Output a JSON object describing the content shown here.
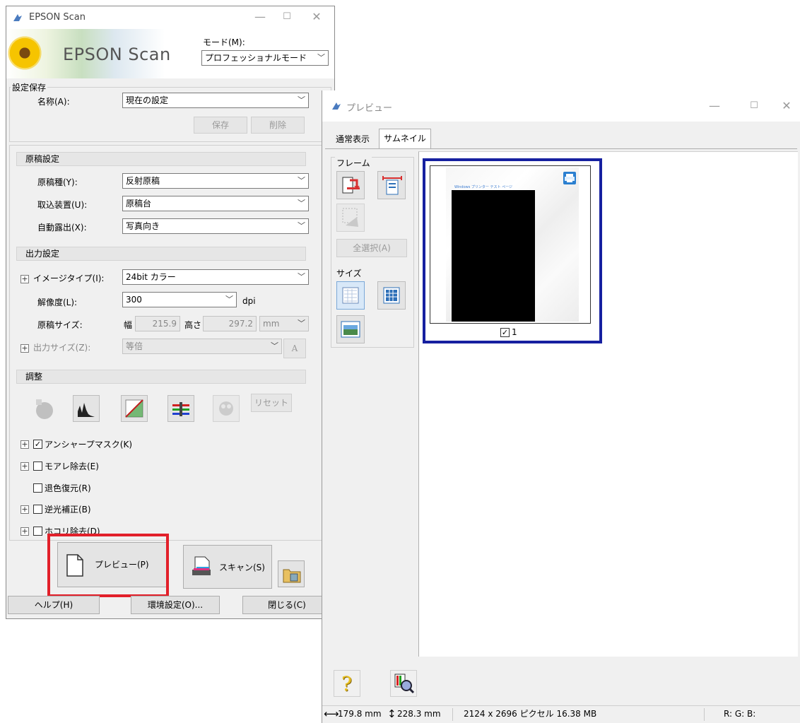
{
  "main": {
    "title": "EPSON Scan",
    "brand": "EPSON Scan",
    "mode_label": "モード(M):",
    "mode_value": "プロフェッショナルモード",
    "settings_save": {
      "group_title": "設定保存",
      "name_label": "名称(A):",
      "name_value": "現在の設定",
      "save_button": "保存",
      "delete_button": "削除"
    },
    "document": {
      "section_title": "原稿設定",
      "type_label": "原稿種(Y):",
      "type_value": "反射原稿",
      "source_label": "取込装置(U):",
      "source_value": "原稿台",
      "exposure_label": "自動露出(X):",
      "exposure_value": "写真向き"
    },
    "output": {
      "section_title": "出力設定",
      "image_type_label": "イメージタイプ(I):",
      "image_type_value": "24bit カラー",
      "resolution_label": "解像度(L):",
      "resolution_value": "300",
      "resolution_unit": "dpi",
      "size_label": "原稿サイズ:",
      "width_label": "幅",
      "width_value": "215.9",
      "height_label": "高さ",
      "height_value": "297.2",
      "size_unit": "mm",
      "target_label": "出力サイズ(Z):",
      "target_value": "等倍"
    },
    "adjust": {
      "section_title": "調整",
      "reset_button": "リセット",
      "unsharp": "アンシャープマスク(K)",
      "moire": "モアレ除去(E)",
      "color_restore": "退色復元(R)",
      "backlight": "逆光補正(B)",
      "dust": "ホコリ除去(D)"
    },
    "preview_button": "プレビュー(P)",
    "scan_button": "スキャン(S)",
    "help_button": "ヘルプ(H)",
    "config_button": "環境設定(O)...",
    "close_button": "閉じる(C)"
  },
  "preview": {
    "title": "プレビュー",
    "tabs": [
      "通常表示",
      "サムネイル"
    ],
    "frame_group": "フレーム",
    "select_all": "全選択(A)",
    "size_group": "サイズ",
    "thumb_header_text": "Windows プリンター テスト ページ",
    "thumb_label": "1",
    "status": {
      "width": "179.8 mm",
      "height": "228.3 mm",
      "pixels": "2124 x 2696 ピクセル 16.38 MB",
      "rgb": "R: G: B:"
    }
  },
  "colors": {
    "highlight_red": "#e2202a",
    "highlight_blue": "#1620a0"
  }
}
